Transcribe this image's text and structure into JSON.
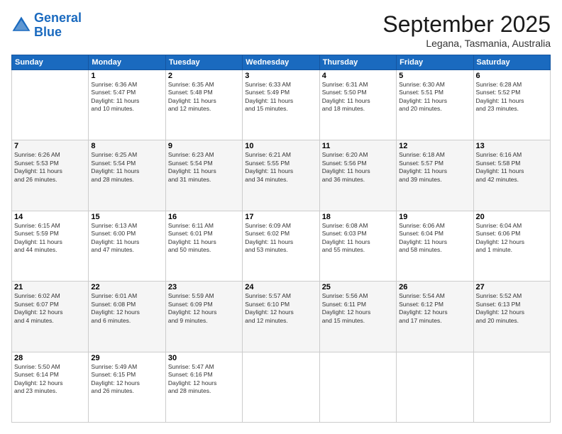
{
  "header": {
    "logo_line1": "General",
    "logo_line2": "Blue",
    "month": "September 2025",
    "location": "Legana, Tasmania, Australia"
  },
  "weekdays": [
    "Sunday",
    "Monday",
    "Tuesday",
    "Wednesday",
    "Thursday",
    "Friday",
    "Saturday"
  ],
  "weeks": [
    [
      {
        "day": "",
        "info": ""
      },
      {
        "day": "1",
        "info": "Sunrise: 6:36 AM\nSunset: 5:47 PM\nDaylight: 11 hours\nand 10 minutes."
      },
      {
        "day": "2",
        "info": "Sunrise: 6:35 AM\nSunset: 5:48 PM\nDaylight: 11 hours\nand 12 minutes."
      },
      {
        "day": "3",
        "info": "Sunrise: 6:33 AM\nSunset: 5:49 PM\nDaylight: 11 hours\nand 15 minutes."
      },
      {
        "day": "4",
        "info": "Sunrise: 6:31 AM\nSunset: 5:50 PM\nDaylight: 11 hours\nand 18 minutes."
      },
      {
        "day": "5",
        "info": "Sunrise: 6:30 AM\nSunset: 5:51 PM\nDaylight: 11 hours\nand 20 minutes."
      },
      {
        "day": "6",
        "info": "Sunrise: 6:28 AM\nSunset: 5:52 PM\nDaylight: 11 hours\nand 23 minutes."
      }
    ],
    [
      {
        "day": "7",
        "info": "Sunrise: 6:26 AM\nSunset: 5:53 PM\nDaylight: 11 hours\nand 26 minutes."
      },
      {
        "day": "8",
        "info": "Sunrise: 6:25 AM\nSunset: 5:54 PM\nDaylight: 11 hours\nand 28 minutes."
      },
      {
        "day": "9",
        "info": "Sunrise: 6:23 AM\nSunset: 5:54 PM\nDaylight: 11 hours\nand 31 minutes."
      },
      {
        "day": "10",
        "info": "Sunrise: 6:21 AM\nSunset: 5:55 PM\nDaylight: 11 hours\nand 34 minutes."
      },
      {
        "day": "11",
        "info": "Sunrise: 6:20 AM\nSunset: 5:56 PM\nDaylight: 11 hours\nand 36 minutes."
      },
      {
        "day": "12",
        "info": "Sunrise: 6:18 AM\nSunset: 5:57 PM\nDaylight: 11 hours\nand 39 minutes."
      },
      {
        "day": "13",
        "info": "Sunrise: 6:16 AM\nSunset: 5:58 PM\nDaylight: 11 hours\nand 42 minutes."
      }
    ],
    [
      {
        "day": "14",
        "info": "Sunrise: 6:15 AM\nSunset: 5:59 PM\nDaylight: 11 hours\nand 44 minutes."
      },
      {
        "day": "15",
        "info": "Sunrise: 6:13 AM\nSunset: 6:00 PM\nDaylight: 11 hours\nand 47 minutes."
      },
      {
        "day": "16",
        "info": "Sunrise: 6:11 AM\nSunset: 6:01 PM\nDaylight: 11 hours\nand 50 minutes."
      },
      {
        "day": "17",
        "info": "Sunrise: 6:09 AM\nSunset: 6:02 PM\nDaylight: 11 hours\nand 53 minutes."
      },
      {
        "day": "18",
        "info": "Sunrise: 6:08 AM\nSunset: 6:03 PM\nDaylight: 11 hours\nand 55 minutes."
      },
      {
        "day": "19",
        "info": "Sunrise: 6:06 AM\nSunset: 6:04 PM\nDaylight: 11 hours\nand 58 minutes."
      },
      {
        "day": "20",
        "info": "Sunrise: 6:04 AM\nSunset: 6:06 PM\nDaylight: 12 hours\nand 1 minute."
      }
    ],
    [
      {
        "day": "21",
        "info": "Sunrise: 6:02 AM\nSunset: 6:07 PM\nDaylight: 12 hours\nand 4 minutes."
      },
      {
        "day": "22",
        "info": "Sunrise: 6:01 AM\nSunset: 6:08 PM\nDaylight: 12 hours\nand 6 minutes."
      },
      {
        "day": "23",
        "info": "Sunrise: 5:59 AM\nSunset: 6:09 PM\nDaylight: 12 hours\nand 9 minutes."
      },
      {
        "day": "24",
        "info": "Sunrise: 5:57 AM\nSunset: 6:10 PM\nDaylight: 12 hours\nand 12 minutes."
      },
      {
        "day": "25",
        "info": "Sunrise: 5:56 AM\nSunset: 6:11 PM\nDaylight: 12 hours\nand 15 minutes."
      },
      {
        "day": "26",
        "info": "Sunrise: 5:54 AM\nSunset: 6:12 PM\nDaylight: 12 hours\nand 17 minutes."
      },
      {
        "day": "27",
        "info": "Sunrise: 5:52 AM\nSunset: 6:13 PM\nDaylight: 12 hours\nand 20 minutes."
      }
    ],
    [
      {
        "day": "28",
        "info": "Sunrise: 5:50 AM\nSunset: 6:14 PM\nDaylight: 12 hours\nand 23 minutes."
      },
      {
        "day": "29",
        "info": "Sunrise: 5:49 AM\nSunset: 6:15 PM\nDaylight: 12 hours\nand 26 minutes."
      },
      {
        "day": "30",
        "info": "Sunrise: 5:47 AM\nSunset: 6:16 PM\nDaylight: 12 hours\nand 28 minutes."
      },
      {
        "day": "",
        "info": ""
      },
      {
        "day": "",
        "info": ""
      },
      {
        "day": "",
        "info": ""
      },
      {
        "day": "",
        "info": ""
      }
    ]
  ]
}
